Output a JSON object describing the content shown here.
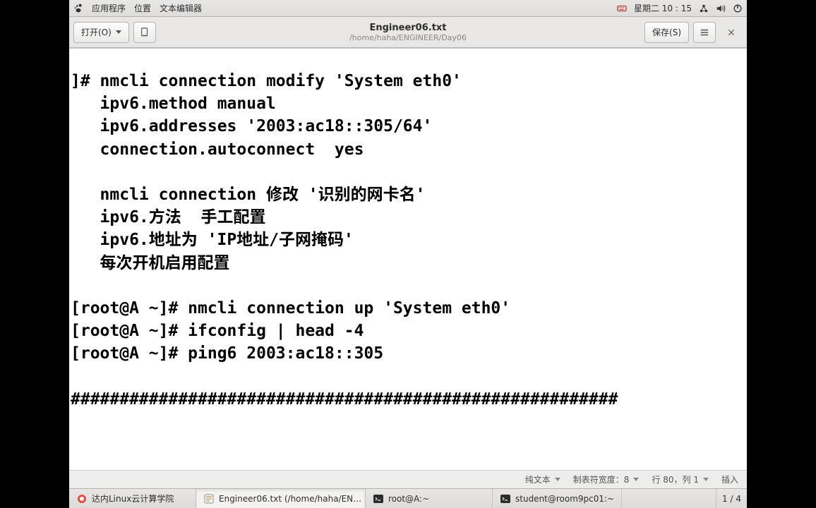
{
  "topbar": {
    "apps": "应用程序",
    "places": "位置",
    "editor": "文本编辑器",
    "clock": "星期二 10 : 15"
  },
  "editor": {
    "open": "打开(O)",
    "save": "保存(S)",
    "title": "Engineer06.txt",
    "path": "/home/haha/ENGINEER/Day06"
  },
  "document": {
    "text": "]# nmcli connection modify 'System eth0'\n   ipv6.method manual\n   ipv6.addresses '2003:ac18::305/64'\n   connection.autoconnect  yes\n\n   nmcli connection 修改 '识别的网卡名'\n   ipv6.方法  手工配置\n   ipv6.地址为 'IP地址/子网掩码'\n   每次开机启用配置\n\n[root@A ~]# nmcli connection up 'System eth0'\n[root@A ~]# ifconfig | head -4\n[root@A ~]# ping6 2003:ac18::305\n\n########################################################"
  },
  "statusbar": {
    "syntax": "纯文本",
    "tabwidth": "制表符宽度：8",
    "cursor": "行 80，列 1",
    "mode": "插入"
  },
  "taskbar": {
    "t1": "达内Linux云计算学院",
    "t2": "Engineer06.txt (/home/haha/EN…",
    "t3": "root@A:~",
    "t4": "student@room9pc01:~",
    "ws": "1 / 4"
  }
}
